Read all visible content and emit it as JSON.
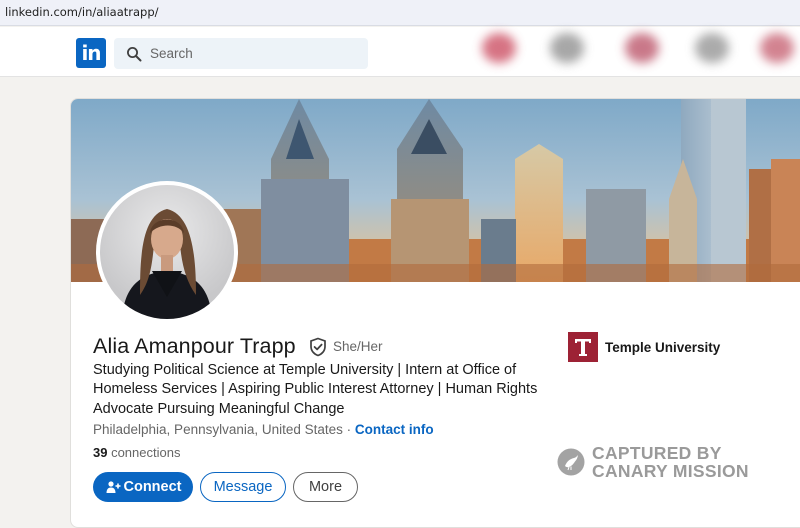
{
  "browser": {
    "url": "linkedin.com/in/aliaatrapp/"
  },
  "nav": {
    "logo_text": "in",
    "search_placeholder": "Search"
  },
  "profile": {
    "name": "Alia Amanpour Trapp",
    "pronouns": "She/Her",
    "headline": "Studying Political Science at Temple University | Intern at Office of Homeless Services | Aspiring Public Interest Attorney | Human Rights Advocate Pursuing Meaningful Change",
    "location": "Philadelphia, Pennsylvania, United States",
    "location_separator": " · ",
    "contact_info_label": "Contact info",
    "connections_count": "39",
    "connections_label": " connections",
    "education": "Temple University"
  },
  "actions": {
    "connect_label": "Connect",
    "message_label": "Message",
    "more_label": "More"
  },
  "watermark": {
    "line1": "CAPTURED BY",
    "line2": "CANARY MISSION"
  },
  "colors": {
    "brand": "#0a66c2",
    "temple_red": "#9d2235",
    "page_bg": "#f3f2ef"
  },
  "icons": {
    "verified": "shield-check-icon",
    "search": "search-icon",
    "connect": "add-person-icon",
    "watermark": "canary-bird-icon"
  }
}
